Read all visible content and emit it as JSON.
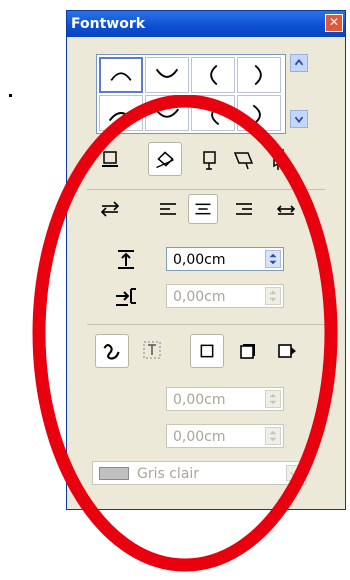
{
  "window": {
    "title": "Fontwork",
    "close_glyph": "✕"
  },
  "shape_gallery": {
    "items": [
      "arc-up-icon",
      "arc-down-icon",
      "arc-left-icon",
      "arc-right-icon",
      "arch-up-icon",
      "arch-down-icon",
      "arch-left-icon",
      "arch-right-icon"
    ],
    "selected_index": 0
  },
  "orientation_buttons": [
    "no-orientation",
    "rotate",
    "upright",
    "slant-horizontal",
    "slant-vertical"
  ],
  "alignment_buttons": [
    "orientation-reverse",
    "align-left",
    "align-center",
    "align-right",
    "autosize-text"
  ],
  "alignment_selected": "align-center",
  "distance": {
    "value": "0,00cm"
  },
  "indent": {
    "value": "0,00cm"
  },
  "contour_buttons": [
    "contour",
    "text-frame",
    "no-shadow",
    "vertical-shadow",
    "slant-shadow"
  ],
  "shadow_x": {
    "value": "0,00cm"
  },
  "shadow_y": {
    "value": "0,00cm"
  },
  "shadow_color": {
    "label": "Gris clair",
    "swatch": "#c0c0c0"
  },
  "colors": {
    "title_bar": "#0b4fd1",
    "panel": "#ece9d8",
    "annotation_ring": "#e8000e"
  }
}
